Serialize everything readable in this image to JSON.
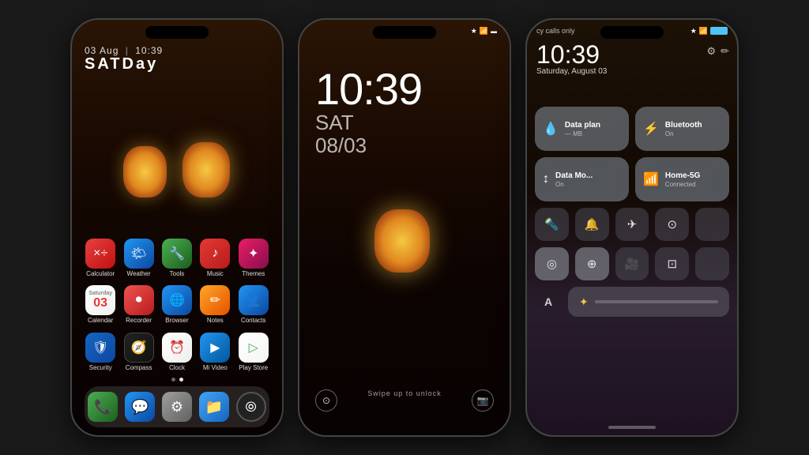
{
  "phone1": {
    "status_bar": {
      "time": "",
      "icons": [
        "★",
        "⬤",
        "▲"
      ]
    },
    "clock": {
      "date": "03 Aug",
      "separator": "|",
      "time": "10:39",
      "day": "SATDay"
    },
    "apps_row1": [
      {
        "label": "Calculator",
        "icon": "×÷",
        "color": "app-calculator"
      },
      {
        "label": "Weather",
        "icon": "🌤",
        "color": "app-weather"
      },
      {
        "label": "Tools",
        "icon": "🔧",
        "color": "app-tools"
      },
      {
        "label": "Music",
        "icon": "♪",
        "color": "app-music"
      },
      {
        "label": "Themes",
        "icon": "✦",
        "color": "app-themes"
      }
    ],
    "apps_row2": [
      {
        "label": "Calendar",
        "icon": "03",
        "color": "app-calendar"
      },
      {
        "label": "Recorder",
        "icon": "⏺",
        "color": "app-recorder"
      },
      {
        "label": "Browser",
        "icon": "🌐",
        "color": "app-browser"
      },
      {
        "label": "Notes",
        "icon": "✏",
        "color": "app-notes"
      },
      {
        "label": "Contacts",
        "icon": "👤",
        "color": "app-contacts"
      }
    ],
    "apps_row3": [
      {
        "label": "Security",
        "icon": "🛡",
        "color": "app-security"
      },
      {
        "label": "Compass",
        "icon": "🧭",
        "color": "app-compass"
      },
      {
        "label": "Clock",
        "icon": "⏰",
        "color": "app-clock"
      },
      {
        "label": "Mi Video",
        "icon": "▶",
        "color": "app-mivideo"
      },
      {
        "label": "Play Store",
        "icon": "▷",
        "color": "app-playstore"
      }
    ],
    "dock": [
      {
        "label": "Phone",
        "icon": "📞",
        "color": "dock-phone"
      },
      {
        "label": "Messages",
        "icon": "💬",
        "color": "dock-messages"
      },
      {
        "label": "Settings",
        "icon": "⚙",
        "color": "dock-settings"
      },
      {
        "label": "Files",
        "icon": "📁",
        "color": "dock-files"
      },
      {
        "label": "Camera",
        "icon": "⦾",
        "color": "dock-camera"
      }
    ]
  },
  "phone2": {
    "time": "10:39",
    "day": "SAT",
    "date": "08/03",
    "swipe_hint": "Swipe up to unlock"
  },
  "phone3": {
    "status_left": "cy calls only",
    "clock": {
      "time": "10:39",
      "date": "Saturday, August 03"
    },
    "tiles": {
      "data_plan": {
        "label": "Data plan",
        "sub": "— MB",
        "icon": "💧"
      },
      "bluetooth": {
        "label": "Bluetooth",
        "sub": "On",
        "icon": "⚡"
      },
      "data_mode": {
        "label": "Data Mo...",
        "sub": "On",
        "icon": "↕"
      },
      "wifi": {
        "label": "Home-5G",
        "sub": "Connected",
        "icon": "📶"
      }
    },
    "small_btns": [
      "🔦",
      "🔔",
      "✈",
      "⊙",
      ""
    ],
    "small_btns2": [
      "◎",
      "⊕",
      "🎥",
      "⊡",
      ""
    ],
    "brightness_label": "A"
  }
}
